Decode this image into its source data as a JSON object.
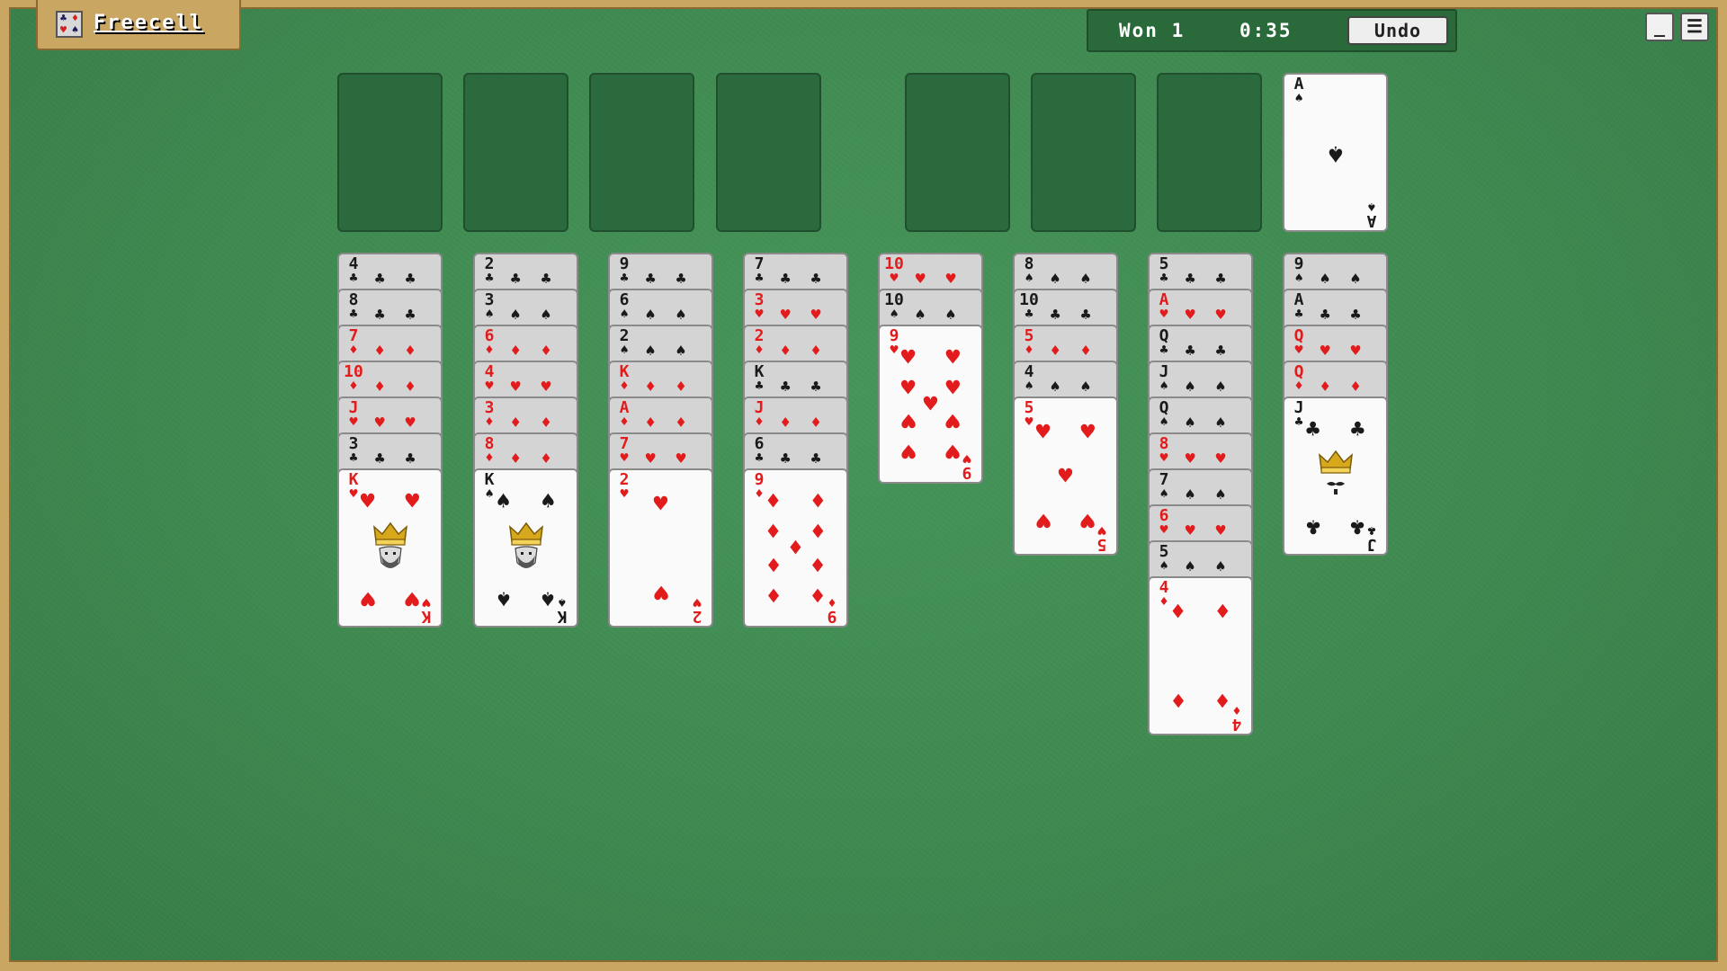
{
  "app": {
    "title": "Freecell",
    "won_label": "Won 1",
    "timer": "0:35",
    "undo_label": "Undo",
    "minimize_glyph": "_",
    "menu_glyph": "☰"
  },
  "colors": {
    "felt": "#428f55",
    "frame": "#c9a661",
    "red_suit": "#e21c1c",
    "black_suit": "#1a1a1a"
  },
  "free_cells": [
    {
      "card": null
    },
    {
      "card": null
    },
    {
      "card": null
    },
    {
      "card": null
    }
  ],
  "foundations": [
    {
      "card": null
    },
    {
      "card": null
    },
    {
      "card": null
    },
    {
      "card": {
        "rank": "A",
        "suit": "spades"
      }
    }
  ],
  "tableau": [
    [
      {
        "rank": "4",
        "suit": "clubs"
      },
      {
        "rank": "8",
        "suit": "clubs"
      },
      {
        "rank": "7",
        "suit": "diamonds"
      },
      {
        "rank": "10",
        "suit": "diamonds"
      },
      {
        "rank": "J",
        "suit": "hearts"
      },
      {
        "rank": "3",
        "suit": "clubs"
      },
      {
        "rank": "K",
        "suit": "hearts"
      }
    ],
    [
      {
        "rank": "2",
        "suit": "clubs"
      },
      {
        "rank": "3",
        "suit": "spades"
      },
      {
        "rank": "6",
        "suit": "diamonds"
      },
      {
        "rank": "4",
        "suit": "hearts"
      },
      {
        "rank": "3",
        "suit": "diamonds"
      },
      {
        "rank": "8",
        "suit": "diamonds"
      },
      {
        "rank": "K",
        "suit": "spades"
      }
    ],
    [
      {
        "rank": "9",
        "suit": "clubs"
      },
      {
        "rank": "6",
        "suit": "spades"
      },
      {
        "rank": "2",
        "suit": "spades"
      },
      {
        "rank": "K",
        "suit": "diamonds"
      },
      {
        "rank": "A",
        "suit": "diamonds"
      },
      {
        "rank": "7",
        "suit": "hearts"
      },
      {
        "rank": "2",
        "suit": "hearts"
      }
    ],
    [
      {
        "rank": "7",
        "suit": "clubs"
      },
      {
        "rank": "3",
        "suit": "hearts"
      },
      {
        "rank": "2",
        "suit": "diamonds"
      },
      {
        "rank": "K",
        "suit": "clubs"
      },
      {
        "rank": "J",
        "suit": "diamonds"
      },
      {
        "rank": "6",
        "suit": "clubs"
      },
      {
        "rank": "9",
        "suit": "diamonds"
      }
    ],
    [
      {
        "rank": "10",
        "suit": "hearts"
      },
      {
        "rank": "10",
        "suit": "spades"
      },
      {
        "rank": "9",
        "suit": "hearts"
      }
    ],
    [
      {
        "rank": "8",
        "suit": "spades"
      },
      {
        "rank": "10",
        "suit": "clubs"
      },
      {
        "rank": "5",
        "suit": "diamonds"
      },
      {
        "rank": "4",
        "suit": "spades"
      },
      {
        "rank": "5",
        "suit": "hearts"
      }
    ],
    [
      {
        "rank": "5",
        "suit": "clubs"
      },
      {
        "rank": "A",
        "suit": "hearts"
      },
      {
        "rank": "Q",
        "suit": "clubs"
      },
      {
        "rank": "J",
        "suit": "spades"
      },
      {
        "rank": "Q",
        "suit": "spades"
      },
      {
        "rank": "8",
        "suit": "hearts"
      },
      {
        "rank": "7",
        "suit": "spades"
      },
      {
        "rank": "6",
        "suit": "hearts"
      },
      {
        "rank": "5",
        "suit": "spades"
      },
      {
        "rank": "4",
        "suit": "diamonds"
      }
    ],
    [
      {
        "rank": "9",
        "suit": "spades"
      },
      {
        "rank": "A",
        "suit": "clubs"
      },
      {
        "rank": "Q",
        "suit": "hearts"
      },
      {
        "rank": "Q",
        "suit": "diamonds"
      },
      {
        "rank": "J",
        "suit": "clubs"
      }
    ]
  ]
}
